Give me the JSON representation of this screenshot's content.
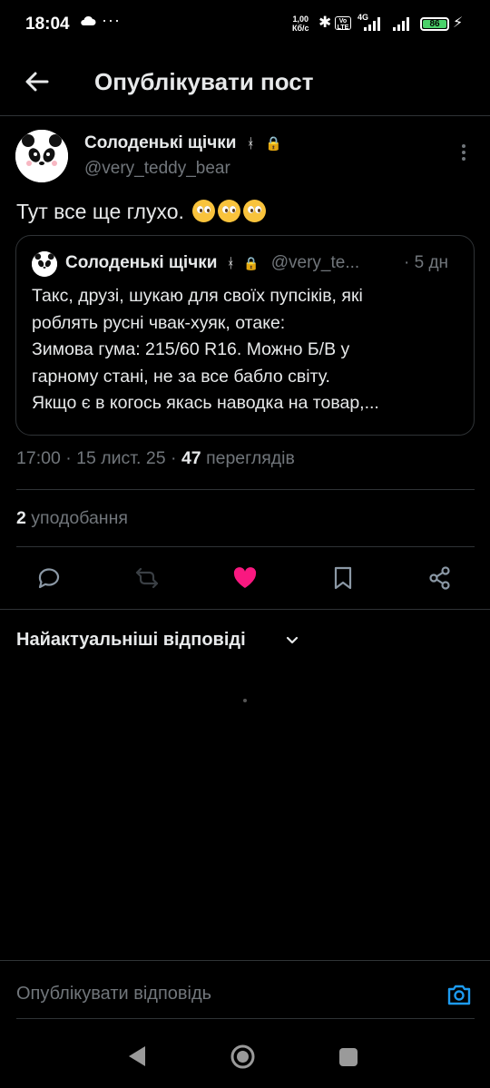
{
  "status_bar": {
    "time": "18:04",
    "more": "···",
    "speed_value": "1,00",
    "speed_unit": "Кб/с",
    "volte": "Vo LTE",
    "network": "4G",
    "battery": "86",
    "icons": [
      "cloud-icon",
      "bluetooth-icon",
      "volte-icon",
      "signal-icon",
      "signal-icon",
      "battery-icon",
      "charging-icon"
    ]
  },
  "header": {
    "title": "Опублікувати пост",
    "back_icon": "arrow-left-icon"
  },
  "post": {
    "author_name": "Солоденькі щічки",
    "author_handle": "@very_teddy_bear",
    "text": "Тут все ще глухо.",
    "emoji": [
      "pleading-face",
      "pleading-face",
      "pleading-face"
    ],
    "time": "17:00",
    "date": "15 лист. 25",
    "views_count": "47",
    "views_label": "переглядів",
    "likes_count": "2",
    "likes_label": "уподобання"
  },
  "quote": {
    "author_name": "Солоденькі щічки",
    "author_handle": "@very_te...",
    "time": "· 5 дн",
    "lines": [
      "Такс, друзі, шукаю для своїх пупсіків, які",
      "роблять русні чвак-хуяк, отаке:",
      "Зимова гума: 215/60 R16. Можно Б/В у",
      "гарному стані, не за все бабло світу.",
      "Якщо є в когось якась наводка на товар,..."
    ]
  },
  "actions": {
    "icons": [
      "reply-icon",
      "repost-icon",
      "like-icon",
      "bookmark-icon",
      "share-icon"
    ],
    "liked_color": "#f91880",
    "repost_disabled_color": "#3a3f44"
  },
  "replies": {
    "sort_label": "Найактуальніші відповіді"
  },
  "composer": {
    "placeholder": "Опублікувати відповідь",
    "accent": "#1d9bf0"
  },
  "nav": {
    "icons": [
      "nav-back-icon",
      "nav-home-icon",
      "nav-recents-icon"
    ]
  }
}
